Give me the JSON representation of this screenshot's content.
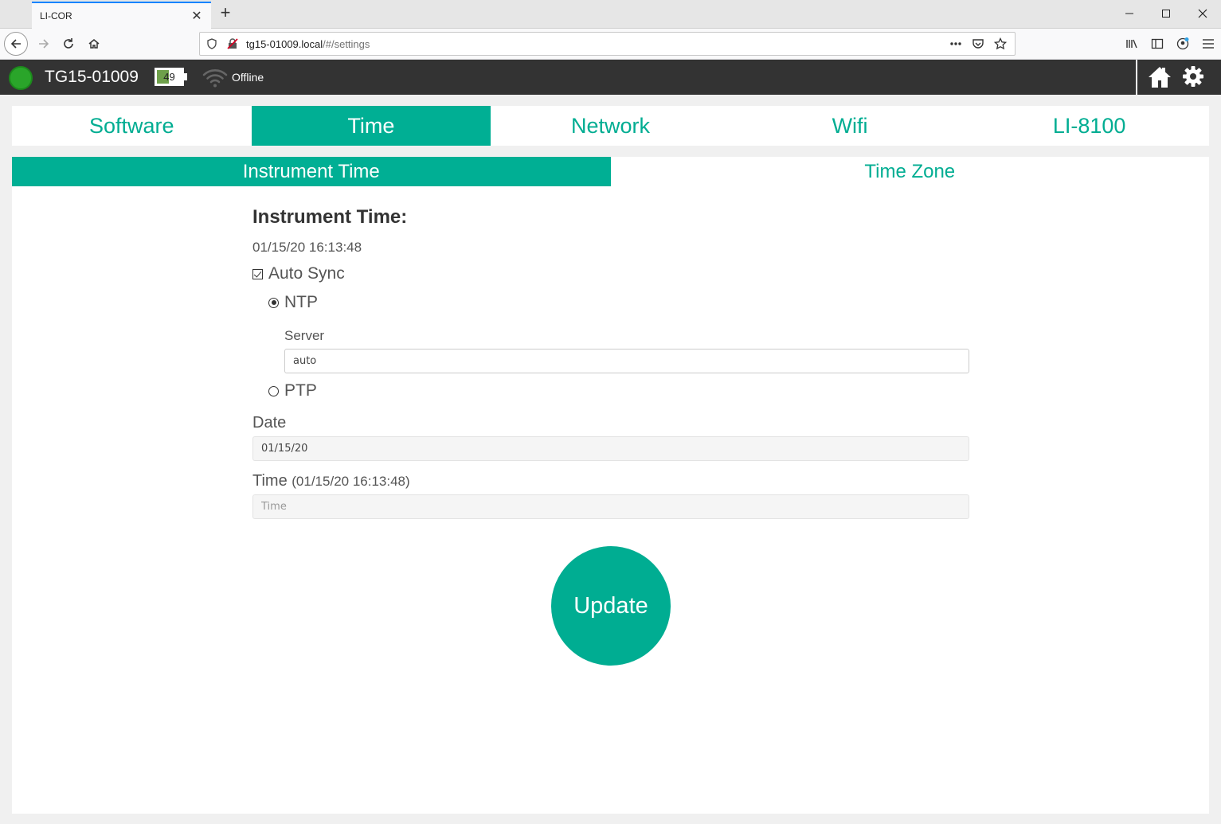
{
  "browser": {
    "tab_title": "LI-COR",
    "url_host": "tg15-01009.local",
    "url_path": "/#/settings"
  },
  "header": {
    "status_color": "#2aa52a",
    "device_name": "TG15-01009",
    "battery_level": "49",
    "battery_fraction": 0.49,
    "wifi_status": "Offline"
  },
  "main_tabs": [
    {
      "label": "Software",
      "active": false
    },
    {
      "label": "Time",
      "active": true
    },
    {
      "label": "Network",
      "active": false
    },
    {
      "label": "Wifi",
      "active": false
    },
    {
      "label": "LI-8100",
      "active": false
    }
  ],
  "sub_tabs": [
    {
      "label": "Instrument Time",
      "active": true
    },
    {
      "label": "Time Zone",
      "active": false
    }
  ],
  "form": {
    "heading": "Instrument Time:",
    "current_time": "01/15/20 16:13:48",
    "auto_sync_label": "Auto Sync",
    "auto_sync_checked": true,
    "ntp_label": "NTP",
    "ntp_selected": true,
    "server_label": "Server",
    "server_value": "auto",
    "ptp_label": "PTP",
    "ptp_selected": false,
    "date_label": "Date",
    "date_value": "01/15/20",
    "time_label": "Time",
    "time_hint": "(01/15/20 16:13:48)",
    "time_placeholder": "Time",
    "update_label": "Update"
  },
  "colors": {
    "accent": "#00af94",
    "header_bg": "#333333"
  }
}
